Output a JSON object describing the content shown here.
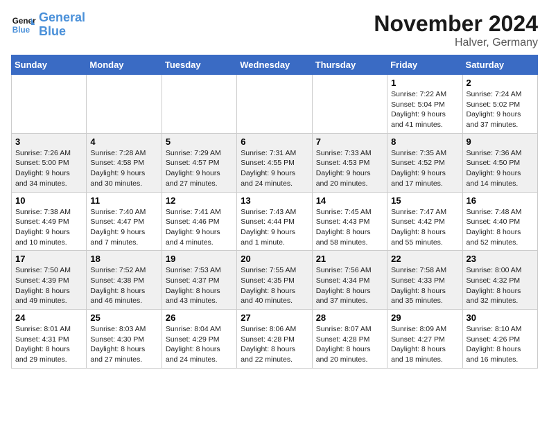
{
  "header": {
    "logo_line1": "General",
    "logo_line2": "Blue",
    "month_title": "November 2024",
    "location": "Halver, Germany"
  },
  "weekdays": [
    "Sunday",
    "Monday",
    "Tuesday",
    "Wednesday",
    "Thursday",
    "Friday",
    "Saturday"
  ],
  "weeks": [
    [
      {
        "day": "",
        "info": ""
      },
      {
        "day": "",
        "info": ""
      },
      {
        "day": "",
        "info": ""
      },
      {
        "day": "",
        "info": ""
      },
      {
        "day": "",
        "info": ""
      },
      {
        "day": "1",
        "info": "Sunrise: 7:22 AM\nSunset: 5:04 PM\nDaylight: 9 hours and 41 minutes."
      },
      {
        "day": "2",
        "info": "Sunrise: 7:24 AM\nSunset: 5:02 PM\nDaylight: 9 hours and 37 minutes."
      }
    ],
    [
      {
        "day": "3",
        "info": "Sunrise: 7:26 AM\nSunset: 5:00 PM\nDaylight: 9 hours and 34 minutes."
      },
      {
        "day": "4",
        "info": "Sunrise: 7:28 AM\nSunset: 4:58 PM\nDaylight: 9 hours and 30 minutes."
      },
      {
        "day": "5",
        "info": "Sunrise: 7:29 AM\nSunset: 4:57 PM\nDaylight: 9 hours and 27 minutes."
      },
      {
        "day": "6",
        "info": "Sunrise: 7:31 AM\nSunset: 4:55 PM\nDaylight: 9 hours and 24 minutes."
      },
      {
        "day": "7",
        "info": "Sunrise: 7:33 AM\nSunset: 4:53 PM\nDaylight: 9 hours and 20 minutes."
      },
      {
        "day": "8",
        "info": "Sunrise: 7:35 AM\nSunset: 4:52 PM\nDaylight: 9 hours and 17 minutes."
      },
      {
        "day": "9",
        "info": "Sunrise: 7:36 AM\nSunset: 4:50 PM\nDaylight: 9 hours and 14 minutes."
      }
    ],
    [
      {
        "day": "10",
        "info": "Sunrise: 7:38 AM\nSunset: 4:49 PM\nDaylight: 9 hours and 10 minutes."
      },
      {
        "day": "11",
        "info": "Sunrise: 7:40 AM\nSunset: 4:47 PM\nDaylight: 9 hours and 7 minutes."
      },
      {
        "day": "12",
        "info": "Sunrise: 7:41 AM\nSunset: 4:46 PM\nDaylight: 9 hours and 4 minutes."
      },
      {
        "day": "13",
        "info": "Sunrise: 7:43 AM\nSunset: 4:44 PM\nDaylight: 9 hours and 1 minute."
      },
      {
        "day": "14",
        "info": "Sunrise: 7:45 AM\nSunset: 4:43 PM\nDaylight: 8 hours and 58 minutes."
      },
      {
        "day": "15",
        "info": "Sunrise: 7:47 AM\nSunset: 4:42 PM\nDaylight: 8 hours and 55 minutes."
      },
      {
        "day": "16",
        "info": "Sunrise: 7:48 AM\nSunset: 4:40 PM\nDaylight: 8 hours and 52 minutes."
      }
    ],
    [
      {
        "day": "17",
        "info": "Sunrise: 7:50 AM\nSunset: 4:39 PM\nDaylight: 8 hours and 49 minutes."
      },
      {
        "day": "18",
        "info": "Sunrise: 7:52 AM\nSunset: 4:38 PM\nDaylight: 8 hours and 46 minutes."
      },
      {
        "day": "19",
        "info": "Sunrise: 7:53 AM\nSunset: 4:37 PM\nDaylight: 8 hours and 43 minutes."
      },
      {
        "day": "20",
        "info": "Sunrise: 7:55 AM\nSunset: 4:35 PM\nDaylight: 8 hours and 40 minutes."
      },
      {
        "day": "21",
        "info": "Sunrise: 7:56 AM\nSunset: 4:34 PM\nDaylight: 8 hours and 37 minutes."
      },
      {
        "day": "22",
        "info": "Sunrise: 7:58 AM\nSunset: 4:33 PM\nDaylight: 8 hours and 35 minutes."
      },
      {
        "day": "23",
        "info": "Sunrise: 8:00 AM\nSunset: 4:32 PM\nDaylight: 8 hours and 32 minutes."
      }
    ],
    [
      {
        "day": "24",
        "info": "Sunrise: 8:01 AM\nSunset: 4:31 PM\nDaylight: 8 hours and 29 minutes."
      },
      {
        "day": "25",
        "info": "Sunrise: 8:03 AM\nSunset: 4:30 PM\nDaylight: 8 hours and 27 minutes."
      },
      {
        "day": "26",
        "info": "Sunrise: 8:04 AM\nSunset: 4:29 PM\nDaylight: 8 hours and 24 minutes."
      },
      {
        "day": "27",
        "info": "Sunrise: 8:06 AM\nSunset: 4:28 PM\nDaylight: 8 hours and 22 minutes."
      },
      {
        "day": "28",
        "info": "Sunrise: 8:07 AM\nSunset: 4:28 PM\nDaylight: 8 hours and 20 minutes."
      },
      {
        "day": "29",
        "info": "Sunrise: 8:09 AM\nSunset: 4:27 PM\nDaylight: 8 hours and 18 minutes."
      },
      {
        "day": "30",
        "info": "Sunrise: 8:10 AM\nSunset: 4:26 PM\nDaylight: 8 hours and 16 minutes."
      }
    ]
  ]
}
